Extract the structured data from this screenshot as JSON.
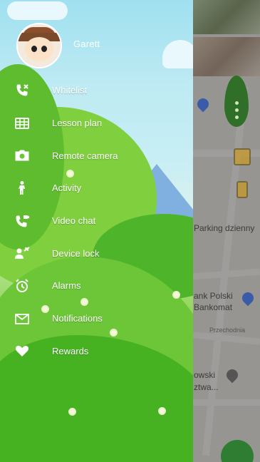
{
  "header": {
    "user_name": "Garett"
  },
  "menu": {
    "items": [
      {
        "id": "whitelist",
        "label": "Whitelist",
        "icon": "phone-x-icon"
      },
      {
        "id": "lesson-plan",
        "label": "Lesson plan",
        "icon": "grid-calendar-icon"
      },
      {
        "id": "remote-camera",
        "label": "Remote camera",
        "icon": "camera-icon"
      },
      {
        "id": "activity",
        "label": "Activity",
        "icon": "walking-person-icon"
      },
      {
        "id": "video-chat",
        "label": "Video chat",
        "icon": "video-phone-icon"
      },
      {
        "id": "device-lock",
        "label": "Device lock",
        "icon": "person-lock-icon"
      },
      {
        "id": "alarms",
        "label": "Alarms",
        "icon": "alarm-clock-icon"
      },
      {
        "id": "notifications",
        "label": "Notifications",
        "icon": "envelope-icon"
      },
      {
        "id": "rewards",
        "label": "Rewards",
        "icon": "heart-icon"
      }
    ]
  },
  "map": {
    "labels": {
      "parking": "Parking dzienny",
      "bank_line1": "ank Polski",
      "bank_line2": "Bankomat",
      "przechodnia": "Przechodnia",
      "street_line1": "owski",
      "street_line2": "ztwa..."
    }
  }
}
